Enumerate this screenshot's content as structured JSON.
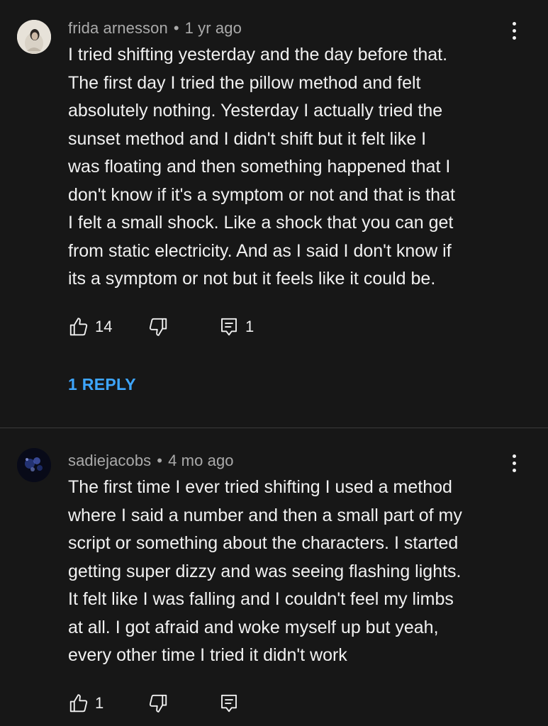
{
  "comments": [
    {
      "author": "frida arnesson",
      "time": "1 yr ago",
      "lines": [
        "I tried shifting yesterday and the day before that.",
        "The first day I tried the pillow method and felt",
        "absolutely nothing. Yesterday I actually tried the",
        "sunset method and I didn't shift but it felt like I",
        "was floating and then something happened that I",
        "don't know if it's a symptom or not and that is that",
        "I felt a small shock. Like a shock that you can get",
        "from static electricity. And as I said I don't know if",
        "its a symptom or not but it feels like it could be."
      ],
      "likes": "14",
      "replies_count": "1",
      "replies_link": "1 REPLY"
    },
    {
      "author": "sadiejacobs",
      "time": "4 mo ago",
      "lines": [
        "The first time I ever tried shifting I used a  method",
        "where I said a number and then a small part of my",
        "script or something about the characters. I started",
        "getting super dizzy and was seeing flashing lights.",
        "It felt like I was falling and I couldn't feel my limbs",
        "at all. I got afraid and woke myself up but yeah,",
        "every other time I tried it didn't work"
      ],
      "likes": "1"
    }
  ],
  "icons": {
    "like": "thumbs-up-icon",
    "dislike": "thumbs-down-icon",
    "reply": "reply-comment-icon",
    "more": "more-vertical-icon"
  },
  "colors": {
    "background": "#171717",
    "text": "#f1f1f1",
    "meta": "#aaaaaa",
    "link": "#3ea6ff",
    "divider": "#3a3a3a"
  }
}
